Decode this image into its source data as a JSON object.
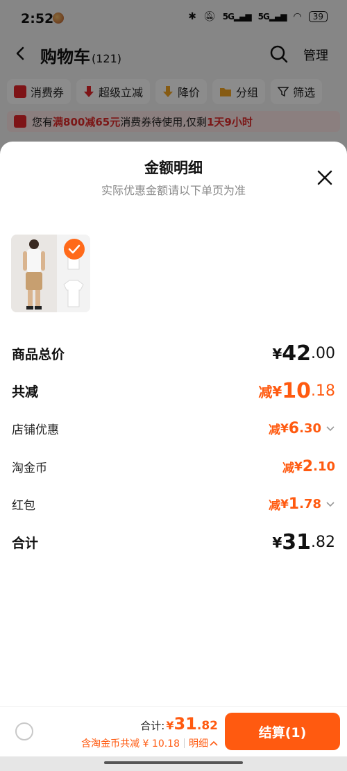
{
  "status_bar": {
    "time": "2:52",
    "network": "5G",
    "battery": "39"
  },
  "nav": {
    "title": "购物车",
    "count": "(121)",
    "manage": "管理"
  },
  "filters": [
    {
      "label": "消费券",
      "icon": "coupon-icon"
    },
    {
      "label": "超级立减",
      "icon": "down-arrow-icon"
    },
    {
      "label": "降价",
      "icon": "price-drop-icon"
    },
    {
      "label": "分组",
      "icon": "folder-icon"
    },
    {
      "label": "筛选",
      "icon": "filter-icon"
    }
  ],
  "banner": {
    "prefix": "您有",
    "highlight": "满800减65元",
    "middle": "消费券待使用,仅剩",
    "time_left": "1天9小时"
  },
  "sheet": {
    "title": "金额明细",
    "subtitle": "实际优惠金额请以下单页为准",
    "rows": {
      "total": {
        "label": "商品总价",
        "currency": "¥",
        "int": "42",
        "dec": ".00"
      },
      "reduce": {
        "label": "共减",
        "prefix": "减",
        "currency": "¥",
        "int": "10",
        "dec": ".18"
      },
      "shop": {
        "label": "店铺优惠",
        "prefix": "减",
        "currency": "¥",
        "int": "6",
        "dec": ".30"
      },
      "coin": {
        "label": "淘金币",
        "prefix": "减",
        "currency": "¥",
        "int": "2",
        "dec": ".10"
      },
      "redpacket": {
        "label": "红包",
        "prefix": "减",
        "currency": "¥",
        "int": "1",
        "dec": ".78"
      },
      "sum": {
        "label": "合计",
        "currency": "¥",
        "int": "31",
        "dec": ".82"
      }
    }
  },
  "checkout": {
    "total_label": "合计:",
    "currency": "¥",
    "int": "31",
    "dec": ".82",
    "discount_text": "含淘金币共减 ¥ 10.18",
    "detail_label": "明细",
    "button_label": "结算(1)"
  },
  "colors": {
    "accent": "#ff5a10",
    "banner_red": "#e12a2a"
  }
}
